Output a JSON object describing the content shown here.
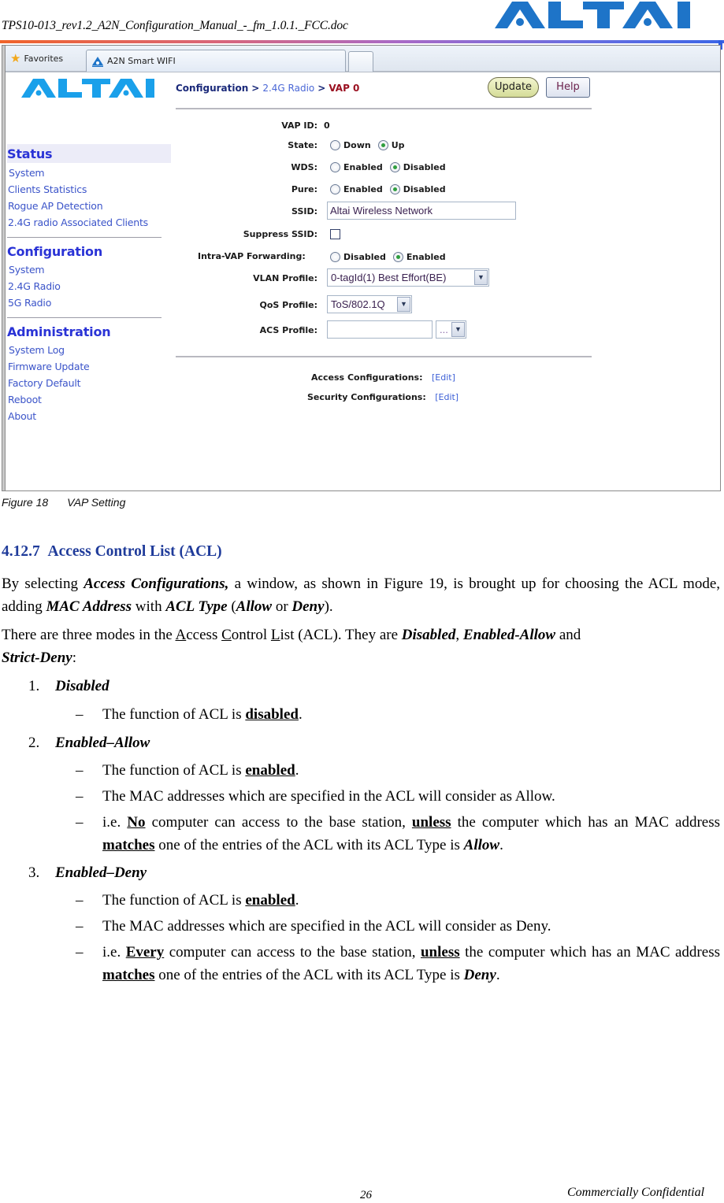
{
  "doc_header": {
    "filename": "TPS10-013_rev1.2_A2N_Configuration_Manual_-_fm_1.0.1._FCC.doc",
    "logo_text": "ALTAI",
    "brand_color": "#1e74c8"
  },
  "browser": {
    "favorites_label": "Favorites",
    "tab_title": "A2N Smart WIFI"
  },
  "sidebar": {
    "logo_text": "ALTAI",
    "sections": [
      {
        "title": "Status",
        "items": [
          "System",
          "Clients Statistics",
          "Rogue AP Detection",
          "2.4G radio Associated Clients"
        ]
      },
      {
        "title": "Configuration",
        "items": [
          "System",
          "2.4G Radio",
          "5G Radio"
        ]
      },
      {
        "title": "Administration",
        "items": [
          "System Log",
          "Firmware Update",
          "Factory Default",
          "Reboot",
          "About"
        ]
      }
    ]
  },
  "content": {
    "breadcrumb": [
      "Configuration",
      ">",
      "2.4G Radio",
      ">",
      "VAP 0"
    ],
    "update_label": "Update",
    "help_label": "Help",
    "fields": {
      "vap_id": {
        "label": "VAP ID:",
        "value": "0"
      },
      "state": {
        "label": "State:",
        "options": [
          "Down",
          "Up"
        ],
        "selected": "Up"
      },
      "wds": {
        "label": "WDS:",
        "options": [
          "Enabled",
          "Disabled"
        ],
        "selected": "Disabled"
      },
      "pure": {
        "label": "Pure:",
        "options": [
          "Enabled",
          "Disabled"
        ],
        "selected": "Disabled"
      },
      "ssid": {
        "label": "SSID:",
        "value": "Altai Wireless Network"
      },
      "suppress_ssid": {
        "label": "Suppress SSID:",
        "checked": false
      },
      "intra_vap": {
        "label": "Intra-VAP Forwarding:",
        "options": [
          "Disabled",
          "Enabled"
        ],
        "selected": "Enabled"
      },
      "vlan_profile": {
        "label": "VLAN Profile:",
        "value": "0-tagId(1) Best Effort(BE)"
      },
      "qos_profile": {
        "label": "QoS Profile:",
        "value": "ToS/802.1Q"
      },
      "acs_profile": {
        "label": "ACS Profile:",
        "value": "",
        "select_value": "..."
      }
    },
    "access_config": {
      "label": "Access Configurations:",
      "link": "[Edit]"
    },
    "security_config": {
      "label": "Security Configurations:",
      "link": "[Edit]"
    },
    "radio_checked_color": "#2f9e3f"
  },
  "caption": {
    "figure": "Figure 18",
    "title": "VAP Setting"
  },
  "section": {
    "number": "4.12.7",
    "title": "Access Control List (ACL)",
    "color": "#1f3b9a"
  },
  "paragraphs": {
    "p1": {
      "t1": "By selecting ",
      "b1": "Access Configurations,",
      "t2": " a window, as shown in Figure 19, is brought up for choosing the ACL mode, adding ",
      "b2": "MAC Address",
      "t3": " with ",
      "b3": "ACL Type",
      "t4": " (",
      "b4": "Allow",
      "t5": " or ",
      "b5": "Deny",
      "t6": ")."
    },
    "p2": {
      "t1": "There are three modes in the ",
      "a": "A",
      "a_rest": "ccess ",
      "c": "C",
      "c_rest": "ontrol ",
      "l": "L",
      "l_rest": "ist (ACL). They are ",
      "b1": "Disabled",
      "t2": ", ",
      "b2": "Enabled-Allow",
      "t3": " and ",
      "b3": "Strict-Deny",
      "t4": ":"
    }
  },
  "modes": [
    {
      "num": "1.",
      "title": "Disabled",
      "bullets": [
        {
          "pre": "The function of ACL is ",
          "strong": "disabled",
          "post": "."
        }
      ]
    },
    {
      "num": "2.",
      "title": "Enabled–Allow",
      "bullets": [
        {
          "pre": "The function of ACL is ",
          "strong": "enabled",
          "post": "."
        },
        {
          "text": "The MAC addresses which are specified in the ACL will consider as Allow."
        },
        {
          "pre": "i.e. ",
          "s1": "No",
          "m1": " computer can access to the base station, ",
          "s2": "unless",
          "m2": " the computer which has an MAC address ",
          "s3": "matches",
          "m3": " one of the entries of the ACL with its ACL Type is ",
          "em": "Allow",
          "post": "."
        }
      ]
    },
    {
      "num": "3.",
      "title": "Enabled–Deny",
      "bullets": [
        {
          "pre": "The function of ACL is ",
          "strong": "enabled",
          "post": "."
        },
        {
          "text": "The MAC addresses which are specified in the ACL will consider as Deny."
        },
        {
          "pre": "i.e. ",
          "s1": "Every",
          "m1": " computer can access to the base station, ",
          "s2": "unless",
          "m2": " the computer which has an MAC address ",
          "s3": "matches",
          "m3": " one of the entries of the ACL with its ACL Type is ",
          "em": "Deny",
          "post": "."
        }
      ]
    }
  ],
  "bullet_dash": "–",
  "footer": {
    "page_number": "26",
    "confidential": "Commercially Confidential"
  }
}
